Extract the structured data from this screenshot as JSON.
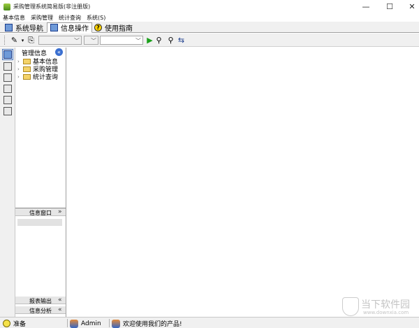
{
  "window": {
    "title": "采购管理系统简易版(非注册版)",
    "min": "—",
    "max": "☐",
    "close": "✕"
  },
  "menu": [
    "基本信息",
    "采购管理",
    "统计查询",
    "系统(S)"
  ],
  "tabs": [
    {
      "label": "系统导航",
      "active": false,
      "icon": "window-icon"
    },
    {
      "label": "信息操作",
      "active": true,
      "icon": "window-icon"
    },
    {
      "label": "使用指南",
      "active": false,
      "icon": "help-icon"
    }
  ],
  "toolbar": {
    "combo_arrow": "﹀"
  },
  "nav": {
    "title": "管理信息",
    "collapse": "«",
    "tree": [
      {
        "label": "基本信息",
        "expander": "›"
      },
      {
        "label": "采购管理",
        "expander": "›"
      },
      {
        "label": "统计查询",
        "expander": "›"
      }
    ],
    "sections": [
      {
        "label": "信息窗口",
        "chevron": "»"
      },
      {
        "label": "报表输出",
        "chevron": "«"
      },
      {
        "label": "信息分析",
        "chevron": "«"
      }
    ]
  },
  "watermark": {
    "text": "当下软件园",
    "url": "www.downxia.com"
  },
  "status": {
    "ready": "准备",
    "user": "Admin",
    "message": "欢迎使用我们的产品!"
  },
  "colors": {
    "accent": "#3a6fd0",
    "folder": "#f4d36a"
  }
}
